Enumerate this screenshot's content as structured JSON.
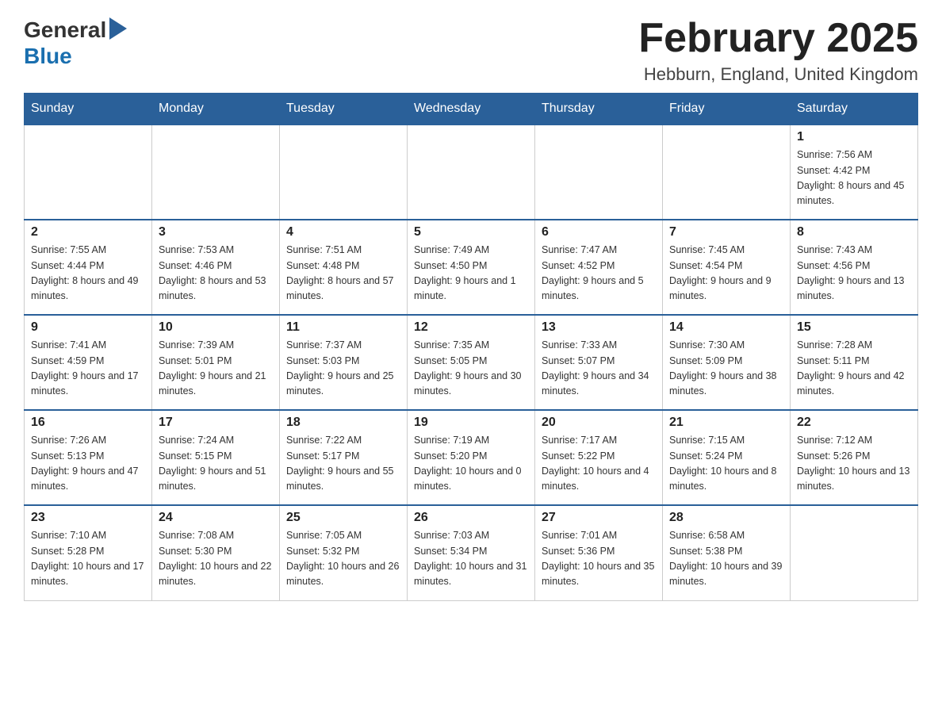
{
  "header": {
    "logo": {
      "general": "General",
      "blue": "Blue"
    },
    "title": "February 2025",
    "location": "Hebburn, England, United Kingdom"
  },
  "days_of_week": [
    "Sunday",
    "Monday",
    "Tuesday",
    "Wednesday",
    "Thursday",
    "Friday",
    "Saturday"
  ],
  "weeks": [
    {
      "days": [
        {
          "date": "",
          "info": ""
        },
        {
          "date": "",
          "info": ""
        },
        {
          "date": "",
          "info": ""
        },
        {
          "date": "",
          "info": ""
        },
        {
          "date": "",
          "info": ""
        },
        {
          "date": "",
          "info": ""
        },
        {
          "date": "1",
          "info": "Sunrise: 7:56 AM\nSunset: 4:42 PM\nDaylight: 8 hours and 45 minutes."
        }
      ]
    },
    {
      "days": [
        {
          "date": "2",
          "info": "Sunrise: 7:55 AM\nSunset: 4:44 PM\nDaylight: 8 hours and 49 minutes."
        },
        {
          "date": "3",
          "info": "Sunrise: 7:53 AM\nSunset: 4:46 PM\nDaylight: 8 hours and 53 minutes."
        },
        {
          "date": "4",
          "info": "Sunrise: 7:51 AM\nSunset: 4:48 PM\nDaylight: 8 hours and 57 minutes."
        },
        {
          "date": "5",
          "info": "Sunrise: 7:49 AM\nSunset: 4:50 PM\nDaylight: 9 hours and 1 minute."
        },
        {
          "date": "6",
          "info": "Sunrise: 7:47 AM\nSunset: 4:52 PM\nDaylight: 9 hours and 5 minutes."
        },
        {
          "date": "7",
          "info": "Sunrise: 7:45 AM\nSunset: 4:54 PM\nDaylight: 9 hours and 9 minutes."
        },
        {
          "date": "8",
          "info": "Sunrise: 7:43 AM\nSunset: 4:56 PM\nDaylight: 9 hours and 13 minutes."
        }
      ]
    },
    {
      "days": [
        {
          "date": "9",
          "info": "Sunrise: 7:41 AM\nSunset: 4:59 PM\nDaylight: 9 hours and 17 minutes."
        },
        {
          "date": "10",
          "info": "Sunrise: 7:39 AM\nSunset: 5:01 PM\nDaylight: 9 hours and 21 minutes."
        },
        {
          "date": "11",
          "info": "Sunrise: 7:37 AM\nSunset: 5:03 PM\nDaylight: 9 hours and 25 minutes."
        },
        {
          "date": "12",
          "info": "Sunrise: 7:35 AM\nSunset: 5:05 PM\nDaylight: 9 hours and 30 minutes."
        },
        {
          "date": "13",
          "info": "Sunrise: 7:33 AM\nSunset: 5:07 PM\nDaylight: 9 hours and 34 minutes."
        },
        {
          "date": "14",
          "info": "Sunrise: 7:30 AM\nSunset: 5:09 PM\nDaylight: 9 hours and 38 minutes."
        },
        {
          "date": "15",
          "info": "Sunrise: 7:28 AM\nSunset: 5:11 PM\nDaylight: 9 hours and 42 minutes."
        }
      ]
    },
    {
      "days": [
        {
          "date": "16",
          "info": "Sunrise: 7:26 AM\nSunset: 5:13 PM\nDaylight: 9 hours and 47 minutes."
        },
        {
          "date": "17",
          "info": "Sunrise: 7:24 AM\nSunset: 5:15 PM\nDaylight: 9 hours and 51 minutes."
        },
        {
          "date": "18",
          "info": "Sunrise: 7:22 AM\nSunset: 5:17 PM\nDaylight: 9 hours and 55 minutes."
        },
        {
          "date": "19",
          "info": "Sunrise: 7:19 AM\nSunset: 5:20 PM\nDaylight: 10 hours and 0 minutes."
        },
        {
          "date": "20",
          "info": "Sunrise: 7:17 AM\nSunset: 5:22 PM\nDaylight: 10 hours and 4 minutes."
        },
        {
          "date": "21",
          "info": "Sunrise: 7:15 AM\nSunset: 5:24 PM\nDaylight: 10 hours and 8 minutes."
        },
        {
          "date": "22",
          "info": "Sunrise: 7:12 AM\nSunset: 5:26 PM\nDaylight: 10 hours and 13 minutes."
        }
      ]
    },
    {
      "days": [
        {
          "date": "23",
          "info": "Sunrise: 7:10 AM\nSunset: 5:28 PM\nDaylight: 10 hours and 17 minutes."
        },
        {
          "date": "24",
          "info": "Sunrise: 7:08 AM\nSunset: 5:30 PM\nDaylight: 10 hours and 22 minutes."
        },
        {
          "date": "25",
          "info": "Sunrise: 7:05 AM\nSunset: 5:32 PM\nDaylight: 10 hours and 26 minutes."
        },
        {
          "date": "26",
          "info": "Sunrise: 7:03 AM\nSunset: 5:34 PM\nDaylight: 10 hours and 31 minutes."
        },
        {
          "date": "27",
          "info": "Sunrise: 7:01 AM\nSunset: 5:36 PM\nDaylight: 10 hours and 35 minutes."
        },
        {
          "date": "28",
          "info": "Sunrise: 6:58 AM\nSunset: 5:38 PM\nDaylight: 10 hours and 39 minutes."
        },
        {
          "date": "",
          "info": ""
        }
      ]
    }
  ]
}
